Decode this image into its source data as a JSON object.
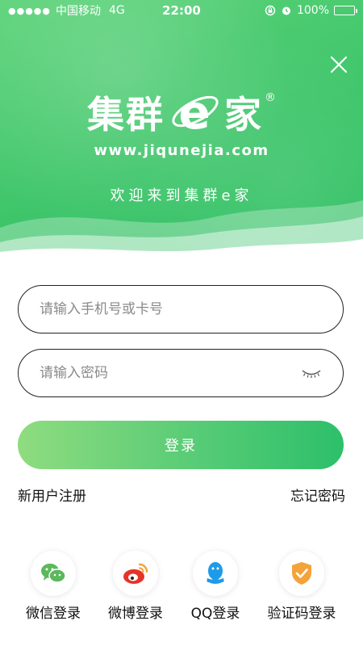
{
  "status_bar": {
    "signal": "●●●●●",
    "carrier": "中国移动",
    "network": "4G",
    "time": "22:00",
    "battery": "100%"
  },
  "brand": {
    "name_part1": "集群",
    "name_part2": "家",
    "reg_mark": "®",
    "url": "www.jiqunejia.com",
    "welcome": "欢迎来到集群e家"
  },
  "form": {
    "phone_placeholder": "请输入手机号或卡号",
    "password_placeholder": "请输入密码",
    "login_label": "登录",
    "register_link": "新用户注册",
    "forgot_link": "忘记密码"
  },
  "social": [
    {
      "label": "微信登录",
      "icon": "wechat-icon",
      "color": "#5cb85c"
    },
    {
      "label": "微博登录",
      "icon": "weibo-icon",
      "color": "#e6332a"
    },
    {
      "label": "QQ登录",
      "icon": "qq-icon",
      "color": "#1e9be8"
    },
    {
      "label": "验证码登录",
      "icon": "verify-shield-icon",
      "color": "#f3a33a"
    }
  ],
  "colors": {
    "brand_green": "#3ec56a",
    "button_start": "#8fdc7f",
    "button_end": "#2dbf6a"
  }
}
